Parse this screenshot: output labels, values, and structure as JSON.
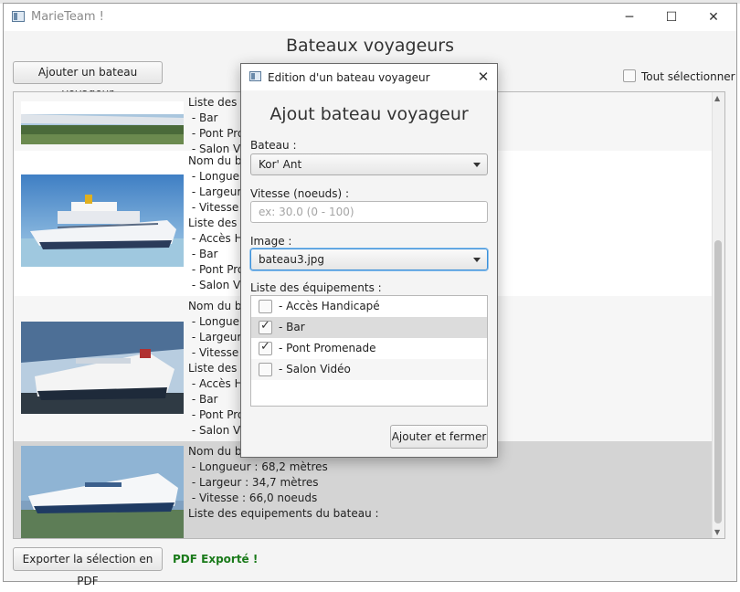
{
  "window": {
    "title": "MarieTeam !",
    "minimize_glyph": "─",
    "maximize_glyph": "☐",
    "close_glyph": "✕"
  },
  "main": {
    "heading": "Bateaux voyageurs",
    "add_button": "Ajouter un bateau voyageur",
    "select_all_label": "Tout sélectionner",
    "export_button": "Exporter la sélection en PDF",
    "export_status": "PDF Exporté !",
    "rows": [
      {
        "text": "Liste des eq\n - Bar\n - Pont Pro\n - Salon Vid"
      },
      {
        "text": "Nom du ba\n - Longueu\n - Largeur :\n - Vitesse :\nListe des eq\n - Accès Ha\n - Bar\n - Pont Pro\n - Salon Vid"
      },
      {
        "text": "Nom du ba\n - Longueu\n - Largeur :\n - Vitesse :\nListe des eq\n - Accès Ha\n - Bar\n - Pont Pro\n - Salon Vid"
      },
      {
        "text": "Nom du ba\n - Longueur : 68,2 mètres\n - Largeur : 34,7 mètres\n - Vitesse : 66,0 noeuds\nListe des equipements du bateau :"
      }
    ]
  },
  "dialog": {
    "title": "Edition d'un bateau voyageur",
    "close_glyph": "✕",
    "heading": "Ajout bateau voyageur",
    "bateau_label": "Bateau :",
    "bateau_value": "Kor' Ant",
    "vitesse_label": "Vitesse (noeuds) :",
    "vitesse_placeholder": "ex: 30.0 (0 - 100)",
    "image_label": "Image :",
    "image_value": "bateau3.jpg",
    "equipements_label": "Liste des équipements :",
    "equipements": [
      {
        "label": " - Accès Handicapé",
        "checked": false
      },
      {
        "label": " - Bar",
        "checked": true
      },
      {
        "label": " - Pont Promenade",
        "checked": true
      },
      {
        "label": " - Salon Vidéo",
        "checked": false
      }
    ],
    "submit_button": "Ajouter et fermer"
  }
}
